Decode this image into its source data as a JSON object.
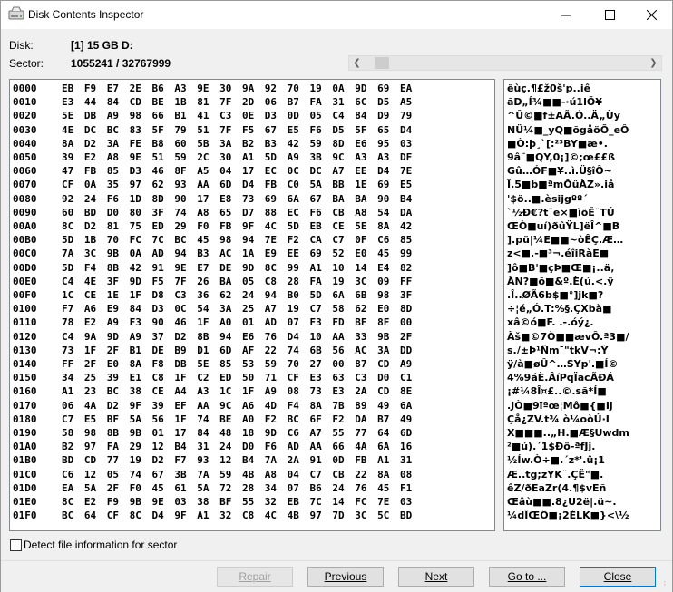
{
  "window": {
    "title": "Disk Contents Inspector"
  },
  "fields": {
    "disk_label": "Disk:",
    "disk_value": "[1] 15 GB D:",
    "sector_label": "Sector:",
    "sector_value": "1055241 / 32767999"
  },
  "hex_rows": [
    {
      "offset": "0000",
      "bytes": "EB F9 E7 2E B6 A3 9E 30 9A 92 70 19 0A 9D 69 EA",
      "ascii": "ëùç.¶£ž0š'p..iê"
    },
    {
      "offset": "0010",
      "bytes": "E3 44 84 CD BE 1B 81 7F 2D 06 B7 FA 31 6C D5 A5",
      "ascii": "ãD„Í¾■■-·ú1lÕ¥"
    },
    {
      "offset": "0020",
      "bytes": "5E DB A9 98 66 B1 41 C3 0E D3 0D 05 C4 84 D9 79",
      "ascii": "^Û©■f±AÃ.Ó..Ä„Ùy"
    },
    {
      "offset": "0030",
      "bytes": "4E DC BC 83 5F 79 51 7F F5 67 E5 F6 D5 5F 65 D4",
      "ascii": "NÜ¼■_yQ■õgåöÕ_eÔ"
    },
    {
      "offset": "0040",
      "bytes": "8A D2 3A FE B8 60 5B 3A B2 B3 42 59 8D E6 95 03",
      "ascii": "■Ò:þ¸`[:²³BY■æ•."
    },
    {
      "offset": "0050",
      "bytes": "39 E2 A8 9E 51 59 2C 30 A1 5D A9 3B 9C A3 A3 DF",
      "ascii": "9â¨■QY,0¡]©;œ££ß"
    },
    {
      "offset": "0060",
      "bytes": "47 FB 85 D3 46 8F A5 04 17 EC 0C DC A7 EE D4 7E",
      "ascii": "Gû…ÓF■¥..ì.Ü§îÔ~"
    },
    {
      "offset": "0070",
      "bytes": "CF 0A 35 97 62 93 AA 6D D4 FB C0 5A BB 1E 69 E5",
      "ascii": "Ï.5■b■ªmÔûÀZ».iå"
    },
    {
      "offset": "0080",
      "bytes": "92 24 F6 1D 8D 90 17 E8 73 69 6A 67 BA BA 90 B4",
      "ascii": "'$ö..■.èsijgºº´"
    },
    {
      "offset": "0090",
      "bytes": "60 BD D0 80 3F 74 A8 65 D7 88 EC F6 CB A8 54 DA",
      "ascii": "`½Ð€?t¨e×■ìöË¨TÚ"
    },
    {
      "offset": "00A0",
      "bytes": "8C D2 81 75 ED 29 F0 FB 9F 4C 5D EB CE 5E 8A 42",
      "ascii": "ŒÒ■uí)ðûŸL]ëÎ^■B"
    },
    {
      "offset": "00B0",
      "bytes": "5D 1B 70 FC 7C BC 45 98 94 7E F2 CA C7 0F C6 85",
      "ascii": "].pü|¼E■■~òÊÇ.Æ…"
    },
    {
      "offset": "00C0",
      "bytes": "7A 3C 9B 0A AD 94 B3 AC 1A E9 EE 69 52 E0 45 99",
      "ascii": "z<■.-■³¬.éîiRàE■"
    },
    {
      "offset": "00D0",
      "bytes": "5D F4 8B 42 91 9E E7 DE 9D 8C 99 A1 10 14 E4 82",
      "ascii": "]ô■B'■çÞ■Œ■¡..ä‚"
    },
    {
      "offset": "00E0",
      "bytes": "C4 4E 3F 9D F5 7F 26 BA 05 C8 28 FA 19 3C 09 FF",
      "ascii": "ÄN?■õ■&º.È(ú.<.ÿ"
    },
    {
      "offset": "00F0",
      "bytes": "1C CE 1E 1F D8 C3 36 62 24 94 B0 5D 6A 6B 98 3F",
      "ascii": ".Î..ØÃ6b$■°]jk■?"
    },
    {
      "offset": "0100",
      "bytes": "F7 A6 E9 84 D3 0C 54 3A 25 A7 19 C7 58 62 E0 8D",
      "ascii": "÷¦é„Ó.T:%§.ÇXbà■"
    },
    {
      "offset": "0110",
      "bytes": "78 E2 A9 F3 90 46 1F A0 01 AD 07 F3 FD BF 8F 00",
      "ascii": "xâ©ó■F. .-.óý¿."
    },
    {
      "offset": "0120",
      "bytes": "C4 9A 9D A9 37 D2 8B 94 E6 76 D4 10 AA 33 9B 2F",
      "ascii": "Äš■©7Ò■■ævÔ.ª3■/"
    },
    {
      "offset": "0130",
      "bytes": "73 1F 2F B1 DE B9 D1 6D AF 22 74 6B 56 AC 3A DD",
      "ascii": "s./±Þ¹Ñm¯\"tkV¬:Ý"
    },
    {
      "offset": "0140",
      "bytes": "FF 2F E0 8A F8 DB 5E 85 53 59 70 27 00 87 CD A9",
      "ascii": "ÿ/à■øÛ^…SYp'.■Í©"
    },
    {
      "offset": "0150",
      "bytes": "34 25 39 E1 C8 1F C2 ED 50 71 CF E3 63 C3 D0 C1",
      "ascii": "4%9áÈ.ÂíPqÏãcÃÐÁ"
    },
    {
      "offset": "0160",
      "bytes": "A1 23 BC 38 CE A4 A3 1C 1F A9 08 73 E3 2A CD 8E",
      "ascii": "¡#¼8Î¤£..©.sã*Í■"
    },
    {
      "offset": "0170",
      "bytes": "06 4A D2 9F 39 EF AA 9C A6 4D F4 8A 7B 89 49 6A",
      "ascii": ".JÒ■9ïªœ¦Mô■{■Ij"
    },
    {
      "offset": "0180",
      "bytes": "C7 E5 BF 5A 56 1F 74 BE A0 F2 BC 6F F2 DA B7 49",
      "ascii": "Çå¿ZV.t¾ ò¼oòÚ·I"
    },
    {
      "offset": "0190",
      "bytes": "58 98 8B 9B 01 17 84 48 18 9D C6 A7 55 77 64 6D",
      "ascii": "X■■■..„H.■Æ§Uwdm"
    },
    {
      "offset": "01A0",
      "bytes": "B2 97 FA 29 12 B4 31 24 D0 F6 AD AA 66 4A 6A 16",
      "ascii": "²■ú).´1$Ðö-ªfJj."
    },
    {
      "offset": "01B0",
      "bytes": "BD CD 77 19 D2 F7 93 12 B4 7A 2A 91 0D FB A1 31",
      "ascii": "½Íw.Ò÷■.´z*'.û¡1"
    },
    {
      "offset": "01C0",
      "bytes": "C6 12 05 74 67 3B 7A 59 4B A8 04 C7 CB 22 8A 08",
      "ascii": "Æ..tg;zYK¨.ÇË\"■."
    },
    {
      "offset": "01D0",
      "bytes": "EA 5A 2F F0 45 61 5A 72 28 34 07 B6 24 76 45 F1",
      "ascii": "êZ/ðEaZr(4.¶$vEñ"
    },
    {
      "offset": "01E0",
      "bytes": "8C E2 F9 9B 9E 03 38 BF 55 32 EB 7C 14 FC 7E 03",
      "ascii": "Œâù■■.8¿U2ë|.ü~."
    },
    {
      "offset": "01F0",
      "bytes": "BC 64 CF 8C D4 9F A1 32 C8 4C 4B 97 7D 3C 5C BD",
      "ascii": "¼dÏŒÔ■¡2ÈLK■}<\\½"
    }
  ],
  "checkbox": {
    "label": "Detect file information for sector",
    "checked": false
  },
  "buttons": {
    "repair": "Repair",
    "previous": "Previous",
    "next": "Next",
    "goto": "Go to ...",
    "close": "Close"
  },
  "icons": {
    "app": "disk-drive-icon",
    "minimize": "minimize-icon",
    "maximize": "maximize-icon",
    "close": "close-icon"
  }
}
